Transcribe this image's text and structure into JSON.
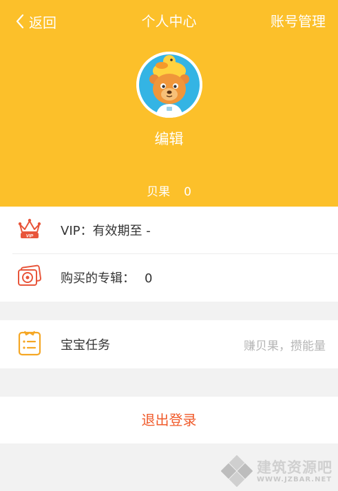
{
  "nav": {
    "back_label": "返回",
    "title": "个人中心",
    "account_label": "账号管理"
  },
  "profile": {
    "edit_label": "编辑",
    "beiguo_label": "贝果",
    "beiguo_value": "0"
  },
  "info": {
    "vip_label": "VIP：",
    "vip_value": "有效期至 -",
    "albums_label": "购买的专辑：",
    "albums_value": "0"
  },
  "task": {
    "label": "宝宝任务",
    "hint": "赚贝果，攒能量"
  },
  "logout_label": "退出登录",
  "watermark": {
    "cn": "建筑资源吧",
    "en": "WWW.JZBAR.NET"
  },
  "colors": {
    "header": "#fcc02a",
    "accent": "#f05a2a"
  },
  "icons": {
    "back": "chevron-left-icon",
    "vip": "crown-icon",
    "albums": "album-icon",
    "task": "clipboard-icon",
    "watermark": "diamond-logo-icon"
  }
}
